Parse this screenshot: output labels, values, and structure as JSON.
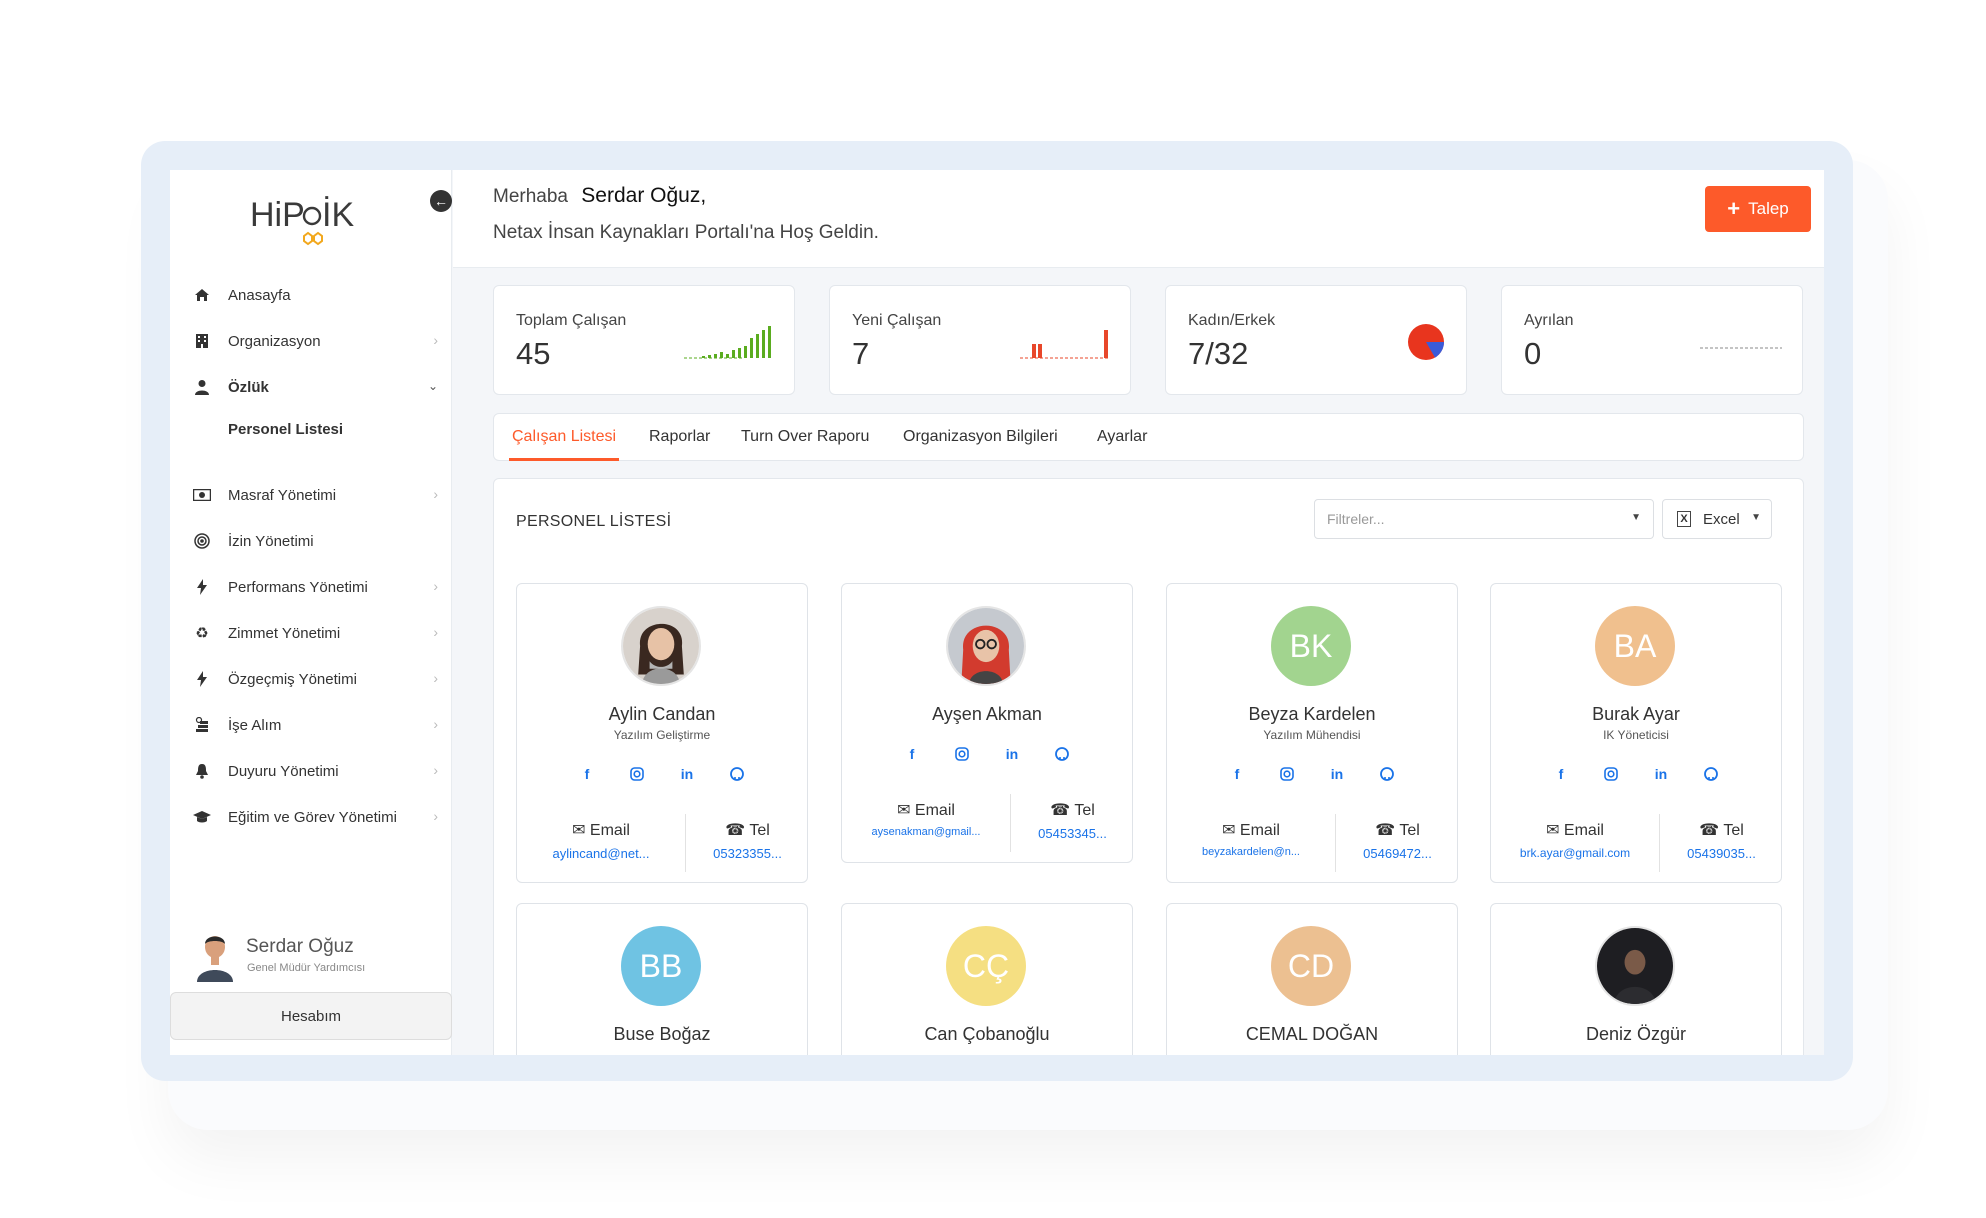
{
  "app": {
    "logo": "HiPoİK"
  },
  "sidebar": {
    "items": [
      {
        "label": "Anasayfa",
        "icon": "home-icon",
        "chevron": false
      },
      {
        "label": "Organizasyon",
        "icon": "building-icon",
        "chevron": true
      },
      {
        "label": "Özlük",
        "icon": "user-icon",
        "chevron": true,
        "expanded": true
      },
      {
        "label": "Masraf Yönetimi",
        "icon": "money-icon",
        "chevron": true
      },
      {
        "label": "İzin Yönetimi",
        "icon": "target-icon",
        "chevron": false
      },
      {
        "label": "Performans Yönetimi",
        "icon": "bolt-icon",
        "chevron": true
      },
      {
        "label": "Zimmet Yönetimi",
        "icon": "recycle-icon",
        "chevron": true
      },
      {
        "label": "Özgeçmiş Yönetimi",
        "icon": "bolt-icon",
        "chevron": true
      },
      {
        "label": "İşe Alım",
        "icon": "coins-icon",
        "chevron": true
      },
      {
        "label": "Duyuru Yönetimi",
        "icon": "bell-icon",
        "chevron": true
      },
      {
        "label": "Eğitim ve Görev Yönetimi",
        "icon": "graduation-cap-icon",
        "chevron": true
      }
    ],
    "subitem": "Personel Listesi",
    "user": {
      "name": "Serdar Oğuz",
      "title": "Genel Müdür Yardımcısı"
    },
    "account_button": "Hesabım"
  },
  "header": {
    "greeting": "Merhaba",
    "user_name": "Serdar Oğuz,",
    "welcome": "Netax İnsan Kaynakları Portalı'na Hoş Geldin.",
    "request_button": "Talep"
  },
  "stats": [
    {
      "label": "Toplam Çalışan",
      "value": "45"
    },
    {
      "label": "Yeni Çalışan",
      "value": "7"
    },
    {
      "label": "Kadın/Erkek",
      "value": "7/32"
    },
    {
      "label": "Ayrılan",
      "value": "0"
    }
  ],
  "tabs": [
    "Çalışan Listesi",
    "Raporlar",
    "Turn Over Raporu",
    "Organizasyon Bilgileri",
    "Ayarlar"
  ],
  "panel": {
    "title": "PERSONEL LİSTESİ",
    "filter_placeholder": "Filtreler...",
    "export_label": "Excel"
  },
  "colors": {
    "accent": "#fd5a2a",
    "link": "#1a73e8",
    "bar_green": "#5aac1f",
    "bar_red": "#e8472a"
  },
  "employees": [
    {
      "name": "Aylin Candan",
      "title": "Yazılım Geliştirme",
      "initials": "",
      "email_label": "Email",
      "email": "aylincand@net...",
      "tel_label": "Tel",
      "tel": "05323355..."
    },
    {
      "name": "Ayşen Akman",
      "title": "",
      "initials": "",
      "email_label": "Email",
      "email": "aysenakman@gmail...",
      "tel_label": "Tel",
      "tel": "05453345..."
    },
    {
      "name": "Beyza Kardelen",
      "title": "Yazılım Mühendisi",
      "initials": "BK",
      "email_label": "Email",
      "email": "beyzakardelen@n...",
      "tel_label": "Tel",
      "tel": "05469472..."
    },
    {
      "name": "Burak Ayar",
      "title": "IK Yöneticisi",
      "initials": "BA",
      "email_label": "Email",
      "email": "brk.ayar@gmail.com",
      "tel_label": "Tel",
      "tel": "05439035..."
    },
    {
      "name": "Buse Boğaz",
      "initials": "BB"
    },
    {
      "name": "Can Çobanoğlu",
      "initials": "CÇ"
    },
    {
      "name": "CEMAL DOĞAN",
      "initials": "CD"
    },
    {
      "name": "Deniz Özgür",
      "initials": ""
    }
  ]
}
